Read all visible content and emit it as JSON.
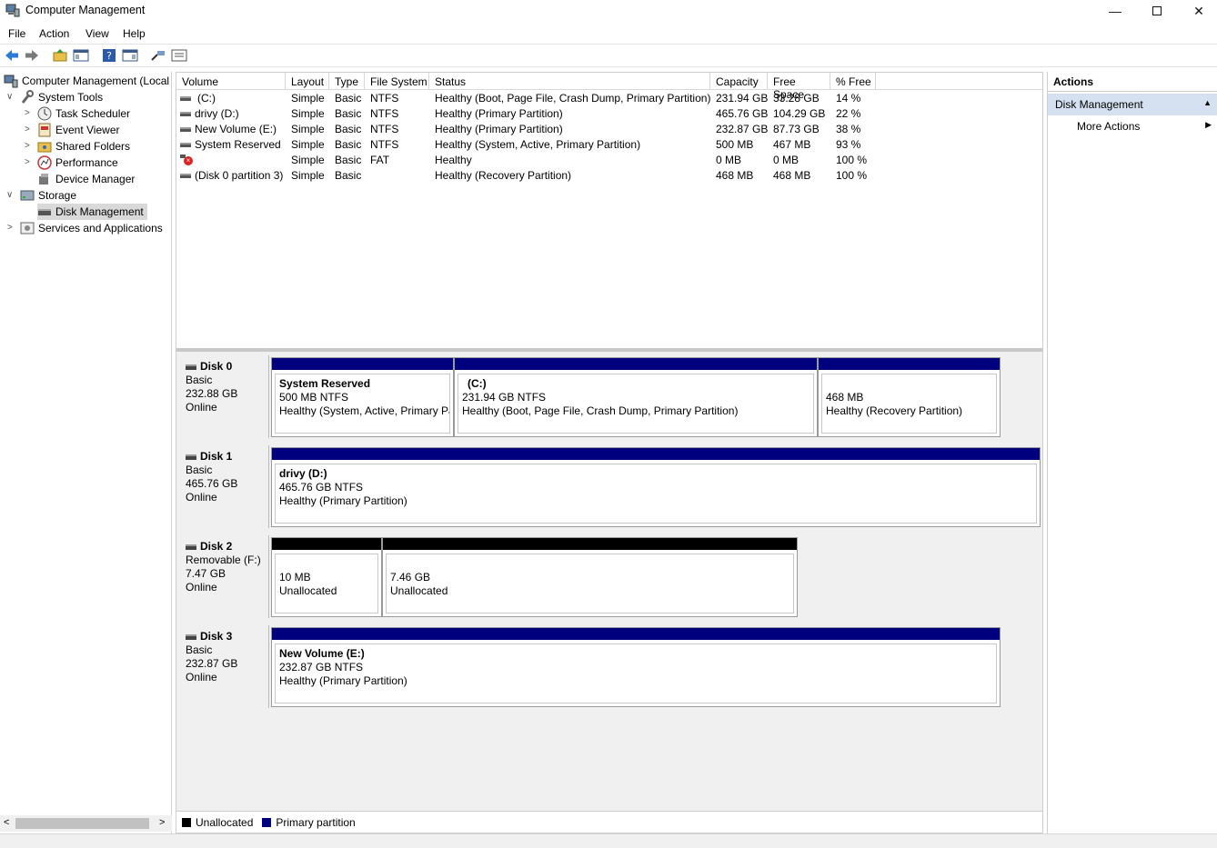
{
  "window": {
    "title": "Computer Management"
  },
  "menu": [
    "File",
    "Action",
    "View",
    "Help"
  ],
  "tree": {
    "root": "Computer Management (Local",
    "system_tools": "System Tools",
    "task_scheduler": "Task Scheduler",
    "event_viewer": "Event Viewer",
    "shared_folders": "Shared Folders",
    "performance": "Performance",
    "device_manager": "Device Manager",
    "storage": "Storage",
    "disk_management": "Disk Management",
    "services": "Services and Applications"
  },
  "volumes": {
    "columns": [
      "Volume",
      "Layout",
      "Type",
      "File System",
      "Status",
      "Capacity",
      "Free Space",
      "% Free"
    ],
    "rows": [
      {
        "volume": "(C:)",
        "layout": "Simple",
        "type": "Basic",
        "fs": "NTFS",
        "status": "Healthy (Boot, Page File, Crash Dump, Primary Partition)",
        "capacity": "231.94 GB",
        "free": "33.28 GB",
        "pct": "14 %"
      },
      {
        "volume": "drivy (D:)",
        "layout": "Simple",
        "type": "Basic",
        "fs": "NTFS",
        "status": "Healthy (Primary Partition)",
        "capacity": "465.76 GB",
        "free": "104.29 GB",
        "pct": "22 %"
      },
      {
        "volume": "New Volume (E:)",
        "layout": "Simple",
        "type": "Basic",
        "fs": "NTFS",
        "status": "Healthy (Primary Partition)",
        "capacity": "232.87 GB",
        "free": "87.73 GB",
        "pct": "38 %"
      },
      {
        "volume": "System Reserved",
        "layout": "Simple",
        "type": "Basic",
        "fs": "NTFS",
        "status": "Healthy (System, Active, Primary Partition)",
        "capacity": "500 MB",
        "free": "467 MB",
        "pct": "93 %"
      },
      {
        "volume": "",
        "layout": "Simple",
        "type": "Basic",
        "fs": "FAT",
        "status": "Healthy",
        "capacity": "0 MB",
        "free": "0 MB",
        "pct": "100 %"
      },
      {
        "volume": "(Disk 0 partition 3)",
        "layout": "Simple",
        "type": "Basic",
        "fs": "",
        "status": "Healthy (Recovery Partition)",
        "capacity": "468 MB",
        "free": "468 MB",
        "pct": "100 %"
      }
    ]
  },
  "disks": {
    "d0": {
      "name": "Disk 0",
      "type": "Basic",
      "size": "232.88 GB",
      "state": "Online",
      "p1": {
        "title": "System Reserved",
        "size": "500 MB NTFS",
        "status": "Healthy (System, Active, Primary Pa"
      },
      "p2": {
        "title": "(C:)",
        "size": "231.94 GB NTFS",
        "status": "Healthy (Boot, Page File, Crash Dump, Primary Partition)"
      },
      "p3": {
        "size": "468 MB",
        "status": "Healthy (Recovery Partition)"
      }
    },
    "d1": {
      "name": "Disk 1",
      "type": "Basic",
      "size": "465.76 GB",
      "state": "Online",
      "p1": {
        "title": "drivy  (D:)",
        "size": "465.76 GB NTFS",
        "status": "Healthy (Primary Partition)"
      }
    },
    "d2": {
      "name": "Disk 2",
      "type": "Removable (F:)",
      "size": "7.47 GB",
      "state": "Online",
      "p1": {
        "size": "10 MB",
        "status": "Unallocated"
      },
      "p2": {
        "size": "7.46 GB",
        "status": "Unallocated"
      }
    },
    "d3": {
      "name": "Disk 3",
      "type": "Basic",
      "size": "232.87 GB",
      "state": "Online",
      "p1": {
        "title": "New Volume  (E:)",
        "size": "232.87 GB NTFS",
        "status": "Healthy (Primary Partition)"
      }
    }
  },
  "legend": {
    "unallocated": "Unallocated",
    "primary": "Primary partition"
  },
  "colors": {
    "primary": "#00007f",
    "unallocated": "#000000",
    "selection": "#d5e1f0"
  },
  "actions": {
    "header": "Actions",
    "section": "Disk Management",
    "more": "More Actions"
  }
}
